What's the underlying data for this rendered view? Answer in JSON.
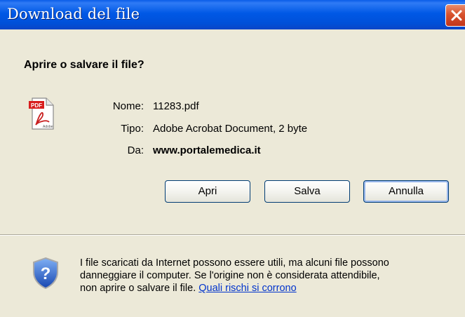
{
  "window": {
    "title": "Download del file",
    "close_icon": "close-icon"
  },
  "dialog": {
    "question": "Aprire o salvare il file?",
    "file_icon": "pdf-file-icon",
    "fields": {
      "name_label": "Nome:",
      "name_value": "11283.pdf",
      "type_label": "Tipo:",
      "type_value": "Adobe Acrobat Document, 2 byte",
      "from_label": "Da:",
      "from_value": "www.portalemedica.it"
    },
    "buttons": {
      "open": "Apri",
      "save": "Salva",
      "cancel": "Annulla"
    }
  },
  "warning": {
    "icon": "security-shield-icon",
    "line1": "I file scaricati da Internet possono essere utili, ma alcuni file possono",
    "line2": "danneggiare il computer. Se l'origine non è considerata attendibile,",
    "line3_prefix": "non aprire o salvare il file. ",
    "link": "Quali rischi si corrono"
  },
  "colors": {
    "titlebar": "#0058e6",
    "dialog_bg": "#ece9d8",
    "close_button": "#d8522d",
    "link": "#0033cc"
  }
}
